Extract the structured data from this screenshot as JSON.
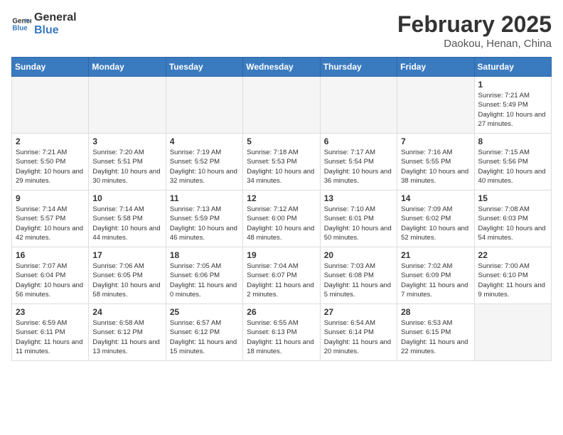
{
  "logo": {
    "line1": "General",
    "line2": "Blue"
  },
  "header": {
    "month": "February 2025",
    "location": "Daokou, Henan, China"
  },
  "weekdays": [
    "Sunday",
    "Monday",
    "Tuesday",
    "Wednesday",
    "Thursday",
    "Friday",
    "Saturday"
  ],
  "weeks": [
    [
      {
        "day": "",
        "info": ""
      },
      {
        "day": "",
        "info": ""
      },
      {
        "day": "",
        "info": ""
      },
      {
        "day": "",
        "info": ""
      },
      {
        "day": "",
        "info": ""
      },
      {
        "day": "",
        "info": ""
      },
      {
        "day": "1",
        "info": "Sunrise: 7:21 AM\nSunset: 5:49 PM\nDaylight: 10 hours\nand 27 minutes."
      }
    ],
    [
      {
        "day": "2",
        "info": "Sunrise: 7:21 AM\nSunset: 5:50 PM\nDaylight: 10 hours\nand 29 minutes."
      },
      {
        "day": "3",
        "info": "Sunrise: 7:20 AM\nSunset: 5:51 PM\nDaylight: 10 hours\nand 30 minutes."
      },
      {
        "day": "4",
        "info": "Sunrise: 7:19 AM\nSunset: 5:52 PM\nDaylight: 10 hours\nand 32 minutes."
      },
      {
        "day": "5",
        "info": "Sunrise: 7:18 AM\nSunset: 5:53 PM\nDaylight: 10 hours\nand 34 minutes."
      },
      {
        "day": "6",
        "info": "Sunrise: 7:17 AM\nSunset: 5:54 PM\nDaylight: 10 hours\nand 36 minutes."
      },
      {
        "day": "7",
        "info": "Sunrise: 7:16 AM\nSunset: 5:55 PM\nDaylight: 10 hours\nand 38 minutes."
      },
      {
        "day": "8",
        "info": "Sunrise: 7:15 AM\nSunset: 5:56 PM\nDaylight: 10 hours\nand 40 minutes."
      }
    ],
    [
      {
        "day": "9",
        "info": "Sunrise: 7:14 AM\nSunset: 5:57 PM\nDaylight: 10 hours\nand 42 minutes."
      },
      {
        "day": "10",
        "info": "Sunrise: 7:14 AM\nSunset: 5:58 PM\nDaylight: 10 hours\nand 44 minutes."
      },
      {
        "day": "11",
        "info": "Sunrise: 7:13 AM\nSunset: 5:59 PM\nDaylight: 10 hours\nand 46 minutes."
      },
      {
        "day": "12",
        "info": "Sunrise: 7:12 AM\nSunset: 6:00 PM\nDaylight: 10 hours\nand 48 minutes."
      },
      {
        "day": "13",
        "info": "Sunrise: 7:10 AM\nSunset: 6:01 PM\nDaylight: 10 hours\nand 50 minutes."
      },
      {
        "day": "14",
        "info": "Sunrise: 7:09 AM\nSunset: 6:02 PM\nDaylight: 10 hours\nand 52 minutes."
      },
      {
        "day": "15",
        "info": "Sunrise: 7:08 AM\nSunset: 6:03 PM\nDaylight: 10 hours\nand 54 minutes."
      }
    ],
    [
      {
        "day": "16",
        "info": "Sunrise: 7:07 AM\nSunset: 6:04 PM\nDaylight: 10 hours\nand 56 minutes."
      },
      {
        "day": "17",
        "info": "Sunrise: 7:06 AM\nSunset: 6:05 PM\nDaylight: 10 hours\nand 58 minutes."
      },
      {
        "day": "18",
        "info": "Sunrise: 7:05 AM\nSunset: 6:06 PM\nDaylight: 11 hours\nand 0 minutes."
      },
      {
        "day": "19",
        "info": "Sunrise: 7:04 AM\nSunset: 6:07 PM\nDaylight: 11 hours\nand 2 minutes."
      },
      {
        "day": "20",
        "info": "Sunrise: 7:03 AM\nSunset: 6:08 PM\nDaylight: 11 hours\nand 5 minutes."
      },
      {
        "day": "21",
        "info": "Sunrise: 7:02 AM\nSunset: 6:09 PM\nDaylight: 11 hours\nand 7 minutes."
      },
      {
        "day": "22",
        "info": "Sunrise: 7:00 AM\nSunset: 6:10 PM\nDaylight: 11 hours\nand 9 minutes."
      }
    ],
    [
      {
        "day": "23",
        "info": "Sunrise: 6:59 AM\nSunset: 6:11 PM\nDaylight: 11 hours\nand 11 minutes."
      },
      {
        "day": "24",
        "info": "Sunrise: 6:58 AM\nSunset: 6:12 PM\nDaylight: 11 hours\nand 13 minutes."
      },
      {
        "day": "25",
        "info": "Sunrise: 6:57 AM\nSunset: 6:12 PM\nDaylight: 11 hours\nand 15 minutes."
      },
      {
        "day": "26",
        "info": "Sunrise: 6:55 AM\nSunset: 6:13 PM\nDaylight: 11 hours\nand 18 minutes."
      },
      {
        "day": "27",
        "info": "Sunrise: 6:54 AM\nSunset: 6:14 PM\nDaylight: 11 hours\nand 20 minutes."
      },
      {
        "day": "28",
        "info": "Sunrise: 6:53 AM\nSunset: 6:15 PM\nDaylight: 11 hours\nand 22 minutes."
      },
      {
        "day": "",
        "info": ""
      }
    ]
  ]
}
